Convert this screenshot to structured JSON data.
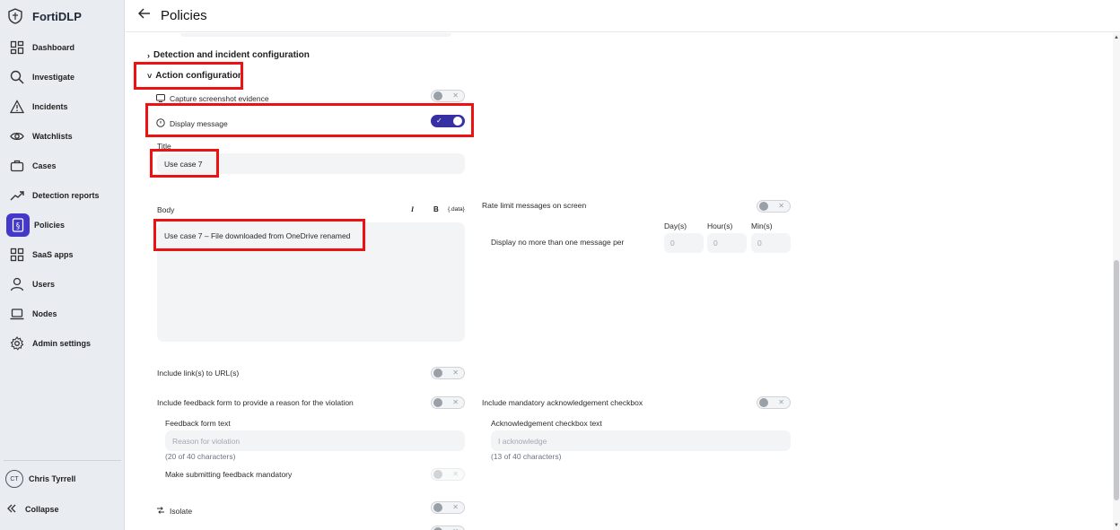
{
  "app": {
    "name": "FortiDLP"
  },
  "sidebar": {
    "items": [
      {
        "key": "dashboard",
        "label": "Dashboard",
        "icon": "dashboard-icon",
        "active": false
      },
      {
        "key": "investigate",
        "label": "Investigate",
        "icon": "search-icon",
        "active": false
      },
      {
        "key": "incidents",
        "label": "Incidents",
        "icon": "warning-icon",
        "active": false
      },
      {
        "key": "watchlists",
        "label": "Watchlists",
        "icon": "eye-icon",
        "active": false
      },
      {
        "key": "cases",
        "label": "Cases",
        "icon": "briefcase-icon",
        "active": false
      },
      {
        "key": "detection-reports",
        "label": "Detection reports",
        "icon": "trend-icon",
        "active": false
      },
      {
        "key": "policies",
        "label": "Policies",
        "icon": "policy-icon",
        "active": true
      },
      {
        "key": "saas-apps",
        "label": "SaaS apps",
        "icon": "apps-grid-icon",
        "active": false
      },
      {
        "key": "users",
        "label": "Users",
        "icon": "user-icon",
        "active": false
      },
      {
        "key": "nodes",
        "label": "Nodes",
        "icon": "laptop-icon",
        "active": false
      },
      {
        "key": "admin-settings",
        "label": "Admin settings",
        "icon": "gear-icon",
        "active": false
      }
    ],
    "user": {
      "initials": "CT",
      "name": "Chris Tyrrell"
    },
    "collapse_label": "Collapse"
  },
  "header": {
    "title": "Policies"
  },
  "sections": {
    "detection": {
      "title": "Detection and incident configuration",
      "expanded": false
    },
    "action": {
      "title": "Action configuration",
      "expanded": true
    }
  },
  "action": {
    "capture_screenshot": {
      "label": "Capture screenshot evidence",
      "enabled": false
    },
    "display_message": {
      "label": "Display message",
      "enabled": true
    },
    "title": {
      "label": "Title",
      "value": "Use case 7"
    },
    "body": {
      "label": "Body",
      "italic_label": "I",
      "bold_label": "B",
      "data_label": "{.data}",
      "value": "Use case 7 – File downloaded from OneDrive renamed"
    },
    "rate_limit": {
      "label": "Rate limit messages on screen",
      "enabled": false,
      "per_label": "Display no more than one message per",
      "day_label": "Day(s)",
      "hour_label": "Hour(s)",
      "min_label": "Min(s)",
      "day_value": "0",
      "hour_value": "0",
      "min_value": "0"
    },
    "include_links": {
      "label": "Include link(s) to URL(s)",
      "enabled": false
    },
    "feedback": {
      "label": "Include feedback form to provide a reason for the violation",
      "enabled": false,
      "text_label": "Feedback form text",
      "placeholder": "Reason for violation",
      "count": "(20 of 40 characters)",
      "mandatory_label": "Make submitting feedback mandatory",
      "mandatory_enabled": false
    },
    "acknowledge": {
      "label": "Include mandatory acknowledgement checkbox",
      "enabled": false,
      "text_label": "Acknowledgement checkbox text",
      "placeholder": "I acknowledge",
      "count": "(13 of 40 characters)"
    },
    "isolate": {
      "label": "Isolate",
      "enabled": false
    }
  },
  "colors": {
    "accent": "#3730a3",
    "highlight": "#ee1111",
    "sidebar_bg": "#e9ecf1"
  }
}
